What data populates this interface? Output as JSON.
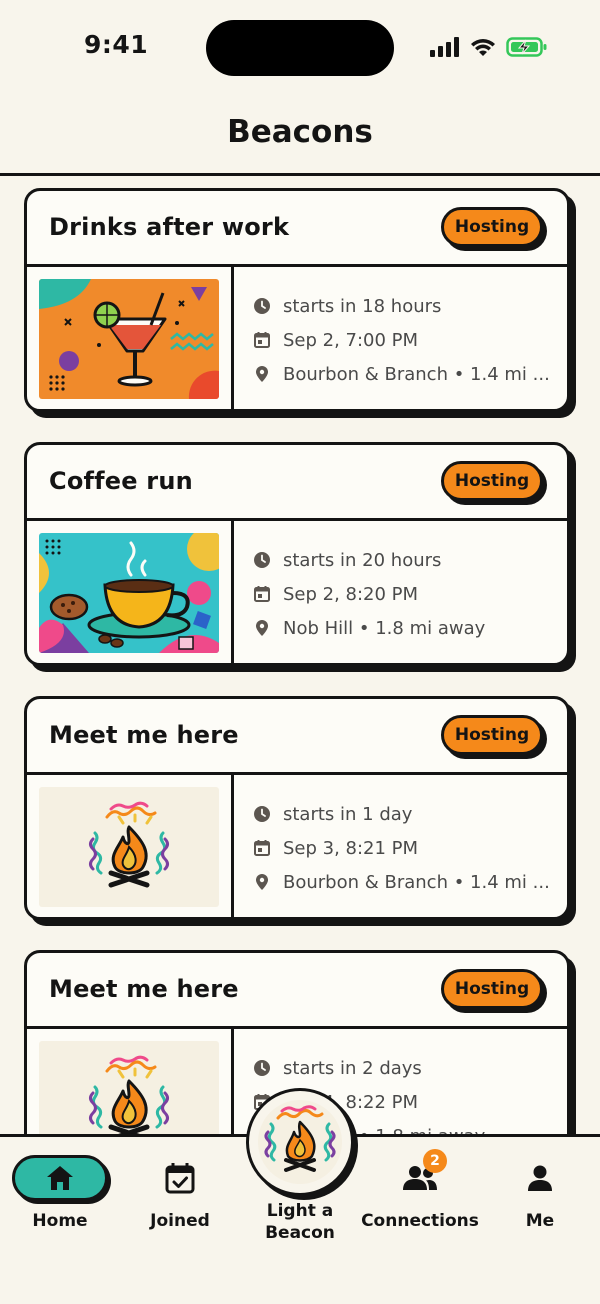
{
  "status_bar": {
    "time": "9:41"
  },
  "header": {
    "title": "Beacons"
  },
  "beacons": [
    {
      "title": "Drinks after work",
      "badge": "Hosting",
      "image": "cocktail-illustration",
      "starts": "starts in 18 hours",
      "date": "Sep 2, 7:00 PM",
      "location": "Bourbon & Branch • 1.4 mi ..."
    },
    {
      "title": "Coffee run",
      "badge": "Hosting",
      "image": "coffee-illustration",
      "starts": "starts in 20 hours",
      "date": "Sep 2, 8:20 PM",
      "location": "Nob Hill • 1.8 mi away"
    },
    {
      "title": "Meet me here",
      "badge": "Hosting",
      "image": "campfire-illustration",
      "starts": "starts in 1 day",
      "date": "Sep 3, 8:21 PM",
      "location": "Bourbon & Branch • 1.4 mi ..."
    },
    {
      "title": "Meet me here",
      "badge": "Hosting",
      "image": "campfire-illustration",
      "starts": "starts in 2 days",
      "date": "Sep 4, 8:22 PM",
      "location": "Nob Hill • 1.8 mi away"
    }
  ],
  "nav": {
    "home": "Home",
    "joined": "Joined",
    "beacon_line1": "Light a",
    "beacon_line2": "Beacon",
    "connections": "Connections",
    "connections_count": "2",
    "me": "Me"
  },
  "colors": {
    "background": "#f8f5ec",
    "accent_orange": "#f5891a",
    "accent_teal": "#2eb8a4",
    "ink": "#141414"
  }
}
